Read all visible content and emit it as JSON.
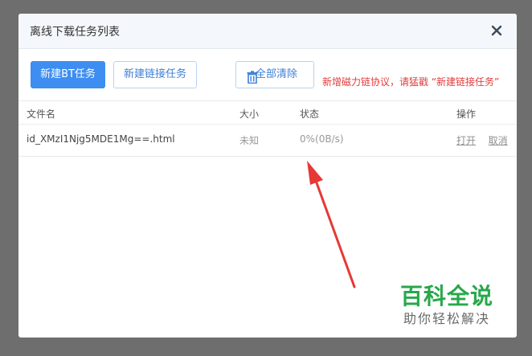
{
  "dialog": {
    "title": "离线下载任务列表"
  },
  "toolbar": {
    "new_bt_label": "新建BT任务",
    "new_link_label": "新建链接任务",
    "clear_all_label": "全部清除",
    "hint": "新增磁力链协议，请猛戳 “新建链接任务”"
  },
  "table": {
    "headers": {
      "name": "文件名",
      "size": "大小",
      "status": "状态",
      "ops": "操作"
    },
    "rows": [
      {
        "name": "id_XMzI1Njg5MDE1Mg==.html",
        "size": "未知",
        "status": "0%(0B/s)",
        "open": "打开",
        "cancel": "取消"
      }
    ]
  },
  "watermark": {
    "main": "百科全说",
    "sub": "助你轻松解决"
  },
  "colors": {
    "accent": "#3d8ef0",
    "hint": "#e43a3a",
    "arrow": "#e53935",
    "watermark": "#27a84a"
  }
}
